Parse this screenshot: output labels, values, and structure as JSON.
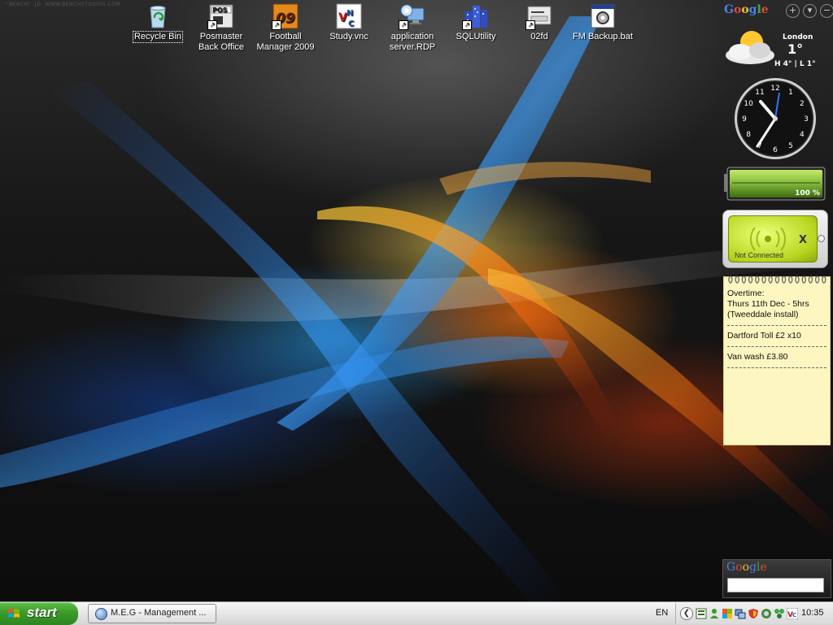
{
  "wallpaper": {
    "credit": "\"BENCH\" .JD. WWW.BENCHSTUDIOS.COM"
  },
  "desktop_icons": [
    {
      "label": "Recycle Bin",
      "icon": "recycle-bin-icon"
    },
    {
      "label": "Posmaster Back Office",
      "icon": "pos-icon",
      "badge": "POS"
    },
    {
      "label": "Football Manager 2009",
      "icon": "football-manager-icon",
      "badge": "09"
    },
    {
      "label": "Study.vnc",
      "icon": "vnc-icon",
      "badge": "VNC"
    },
    {
      "label": "application server.RDP",
      "icon": "remote-desktop-icon"
    },
    {
      "label": "SQLUtility",
      "icon": "sql-utility-icon"
    },
    {
      "label": "02fd",
      "icon": "drive-icon"
    },
    {
      "label": "FM Backup.bat",
      "icon": "batch-file-icon"
    }
  ],
  "sidebar": {
    "header_logo": "Google",
    "header_buttons": [
      "+",
      "▾",
      "−"
    ],
    "weather": {
      "city": "London",
      "temp": "1°",
      "high_low": "H 4° | L 1°"
    },
    "clock": {
      "numbers": [
        "12",
        "1",
        "2",
        "3",
        "4",
        "5",
        "6",
        "7",
        "8",
        "9",
        "10",
        "11"
      ]
    },
    "battery": {
      "percent": "100 %",
      "level": 1.0
    },
    "wifi": {
      "status": "Not Connected",
      "mark": "X"
    },
    "notes": {
      "lines": [
        "Overtime:",
        "Thurs 11th Dec - 5hrs",
        "(Tweeddale install)",
        "Dartford Toll £2 x10",
        "Van wash £3.80"
      ]
    },
    "search": {
      "logo": "Google",
      "placeholder": ""
    }
  },
  "taskbar": {
    "start_label": "start",
    "tasks": [
      {
        "label": "M.E.G - Management ..."
      }
    ],
    "language": "EN",
    "tray_chevron": "❮",
    "time": "10:35"
  },
  "colors": {
    "start_green": "#3a9b2a",
    "battery_green": "#7fb83a",
    "wifi_green": "#b7d51f",
    "notes_yellow": "#fdf6c0"
  }
}
